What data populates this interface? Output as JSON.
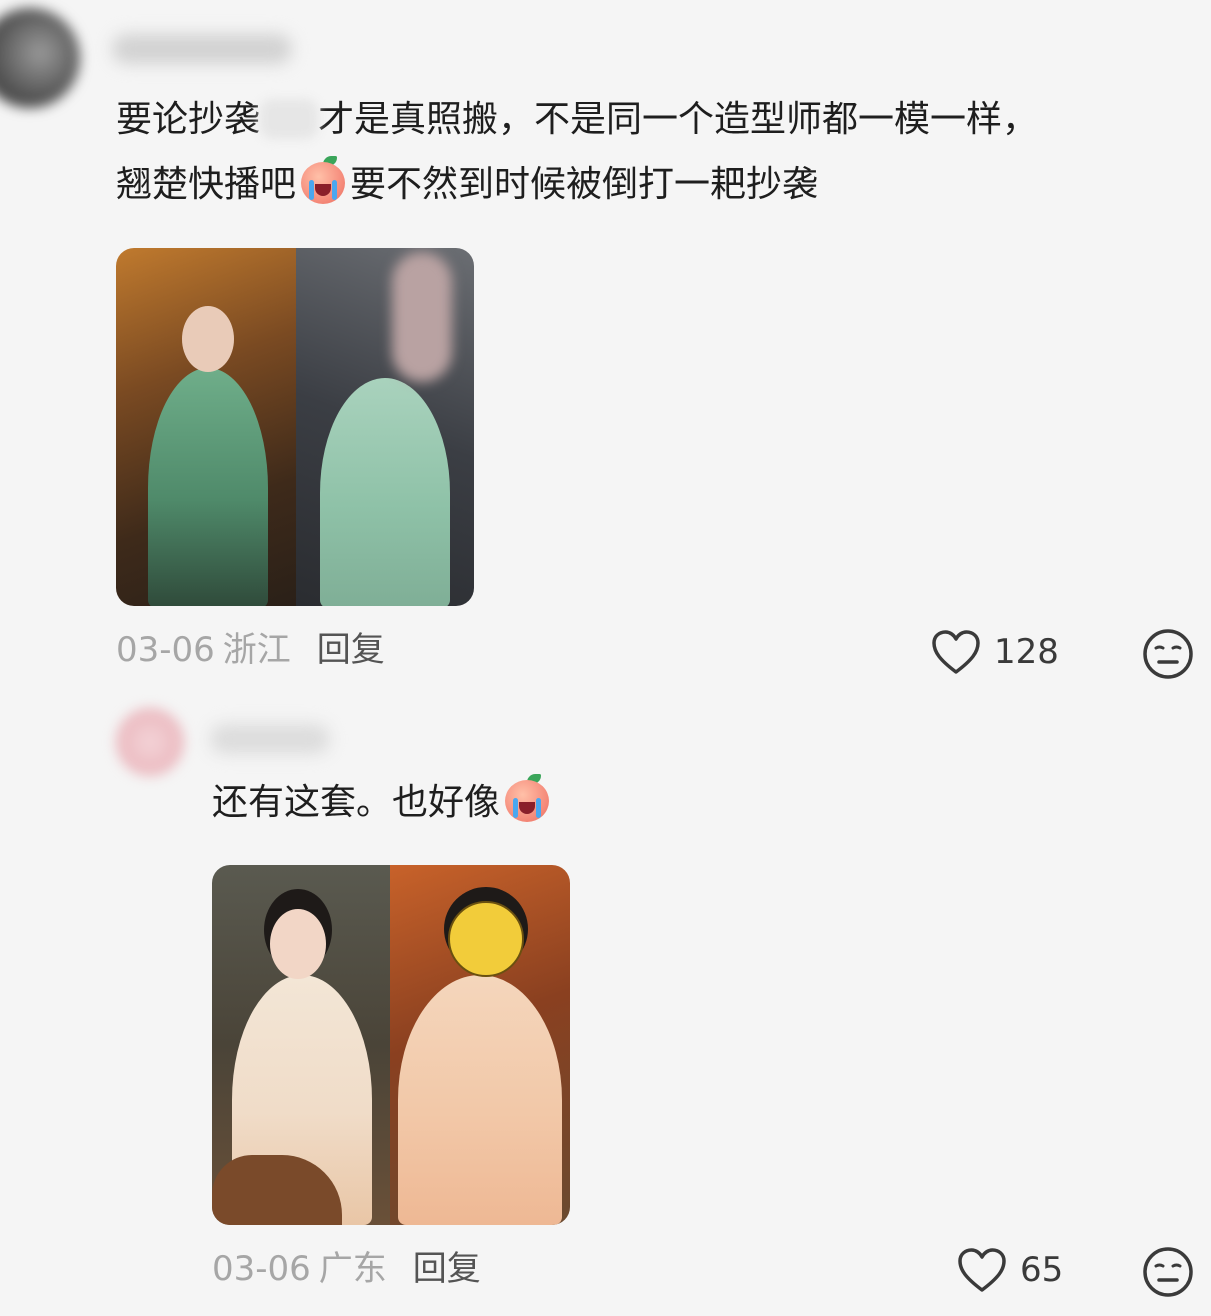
{
  "comments": [
    {
      "text_line1_before": "要论抄袭",
      "text_line1_after": "才是真照搬，不是同一个造型师都一模一样，",
      "text_line2_before": "翘楚快播吧",
      "text_line2_after": "要不然到时候被倒打一耙抄袭",
      "date": "03-06",
      "region": "浙江",
      "reply_label": "回复",
      "likes": "128",
      "emoji_icon": "crying-peach-icon"
    },
    {
      "text_before": "还有这套。也好像",
      "date": "03-06",
      "region": "广东",
      "reply_label": "回复",
      "likes": "65",
      "emoji_icon": "crying-peach-icon"
    }
  ],
  "icons": {
    "like": "heart-outline-icon",
    "react": "neutral-face-icon"
  },
  "colors": {
    "background": "#f5f5f5",
    "text": "#1e1e1e",
    "meta_gray": "#a6a6a6",
    "reply": "#545454"
  }
}
